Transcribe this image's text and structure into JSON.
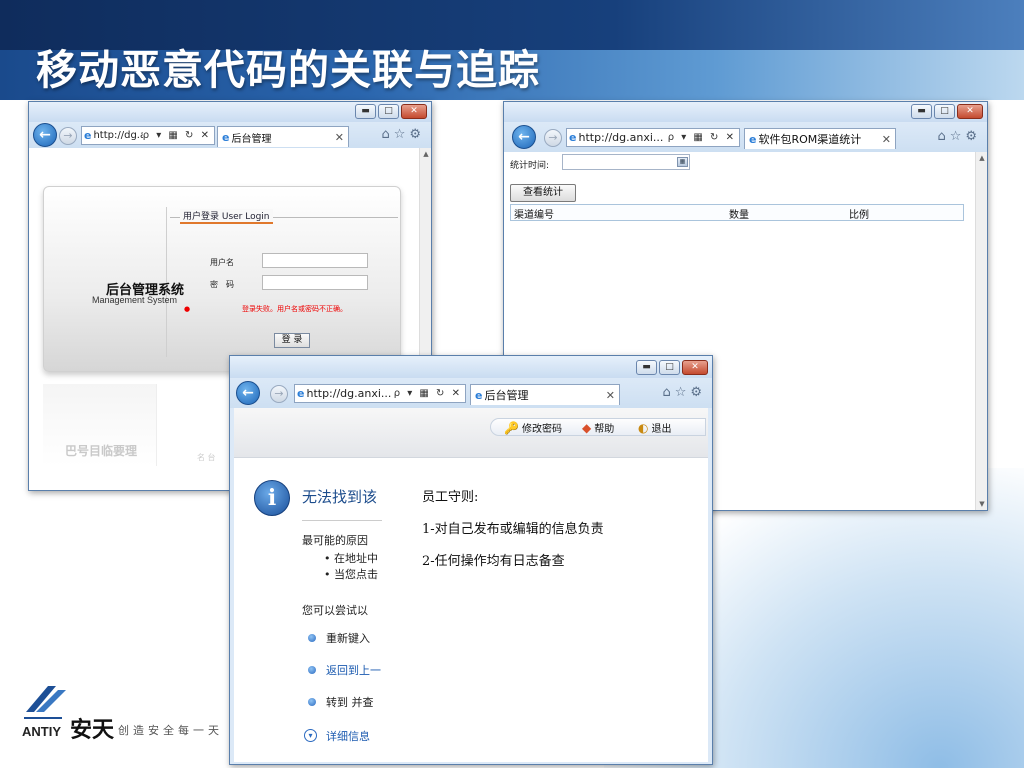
{
  "slide": {
    "title": "移动恶意代码的关联与追踪",
    "logo": {
      "brand_en": "ANTIY",
      "brand_cn": "安天",
      "slogan": "创造安全每一天"
    }
  },
  "windows": {
    "login": {
      "url": "http://dg.anxi...",
      "address_tools": "ρ ▾ ▦ ↻ ✕",
      "tab_title": "后台管理",
      "heading": "用户登录 User Login",
      "system_name_cn": "后台管理系统",
      "system_name_en": "Management System",
      "username_label": "用户名",
      "password_label": "密　码",
      "error_message": "登录失败。用户名或密码不正确。",
      "login_button": "登 录",
      "watermark": "巴号目临要理",
      "watermark_small": "名 台"
    },
    "stats": {
      "url": "http://dg.anxi...",
      "address_tools": "ρ ▾ ▦ ↻ ✕",
      "tab_title": "软件包ROM渠道统计",
      "date_label": "统计时间:",
      "query_button": "查看统计",
      "table_headers": [
        "渠道编号",
        "数量",
        "比例"
      ]
    },
    "front": {
      "url": "http://dg.anxi...",
      "address_tools": "ρ ▾ ▦ ↻ ✕",
      "tab_title": "后台管理",
      "commands": [
        "修改密码",
        "帮助",
        "退出"
      ],
      "error_page": {
        "title": "无法找到该",
        "cause_heading": "最可能的原因",
        "cause_items": [
          "• 在地址中",
          "• 当您点击"
        ],
        "try_heading": "您可以尝试以",
        "actions": [
          "重新键入",
          "返回到上一",
          "转到 并查"
        ],
        "details_link": "详细信息"
      },
      "rules": [
        "员工守则:",
        "1-对自己发布或编辑的信息负责",
        "2-任何操作均有日志备查"
      ]
    }
  },
  "colors": {
    "title_band": "#17407c",
    "error_text": "#e00000",
    "link_blue": "#1c5bb0"
  }
}
